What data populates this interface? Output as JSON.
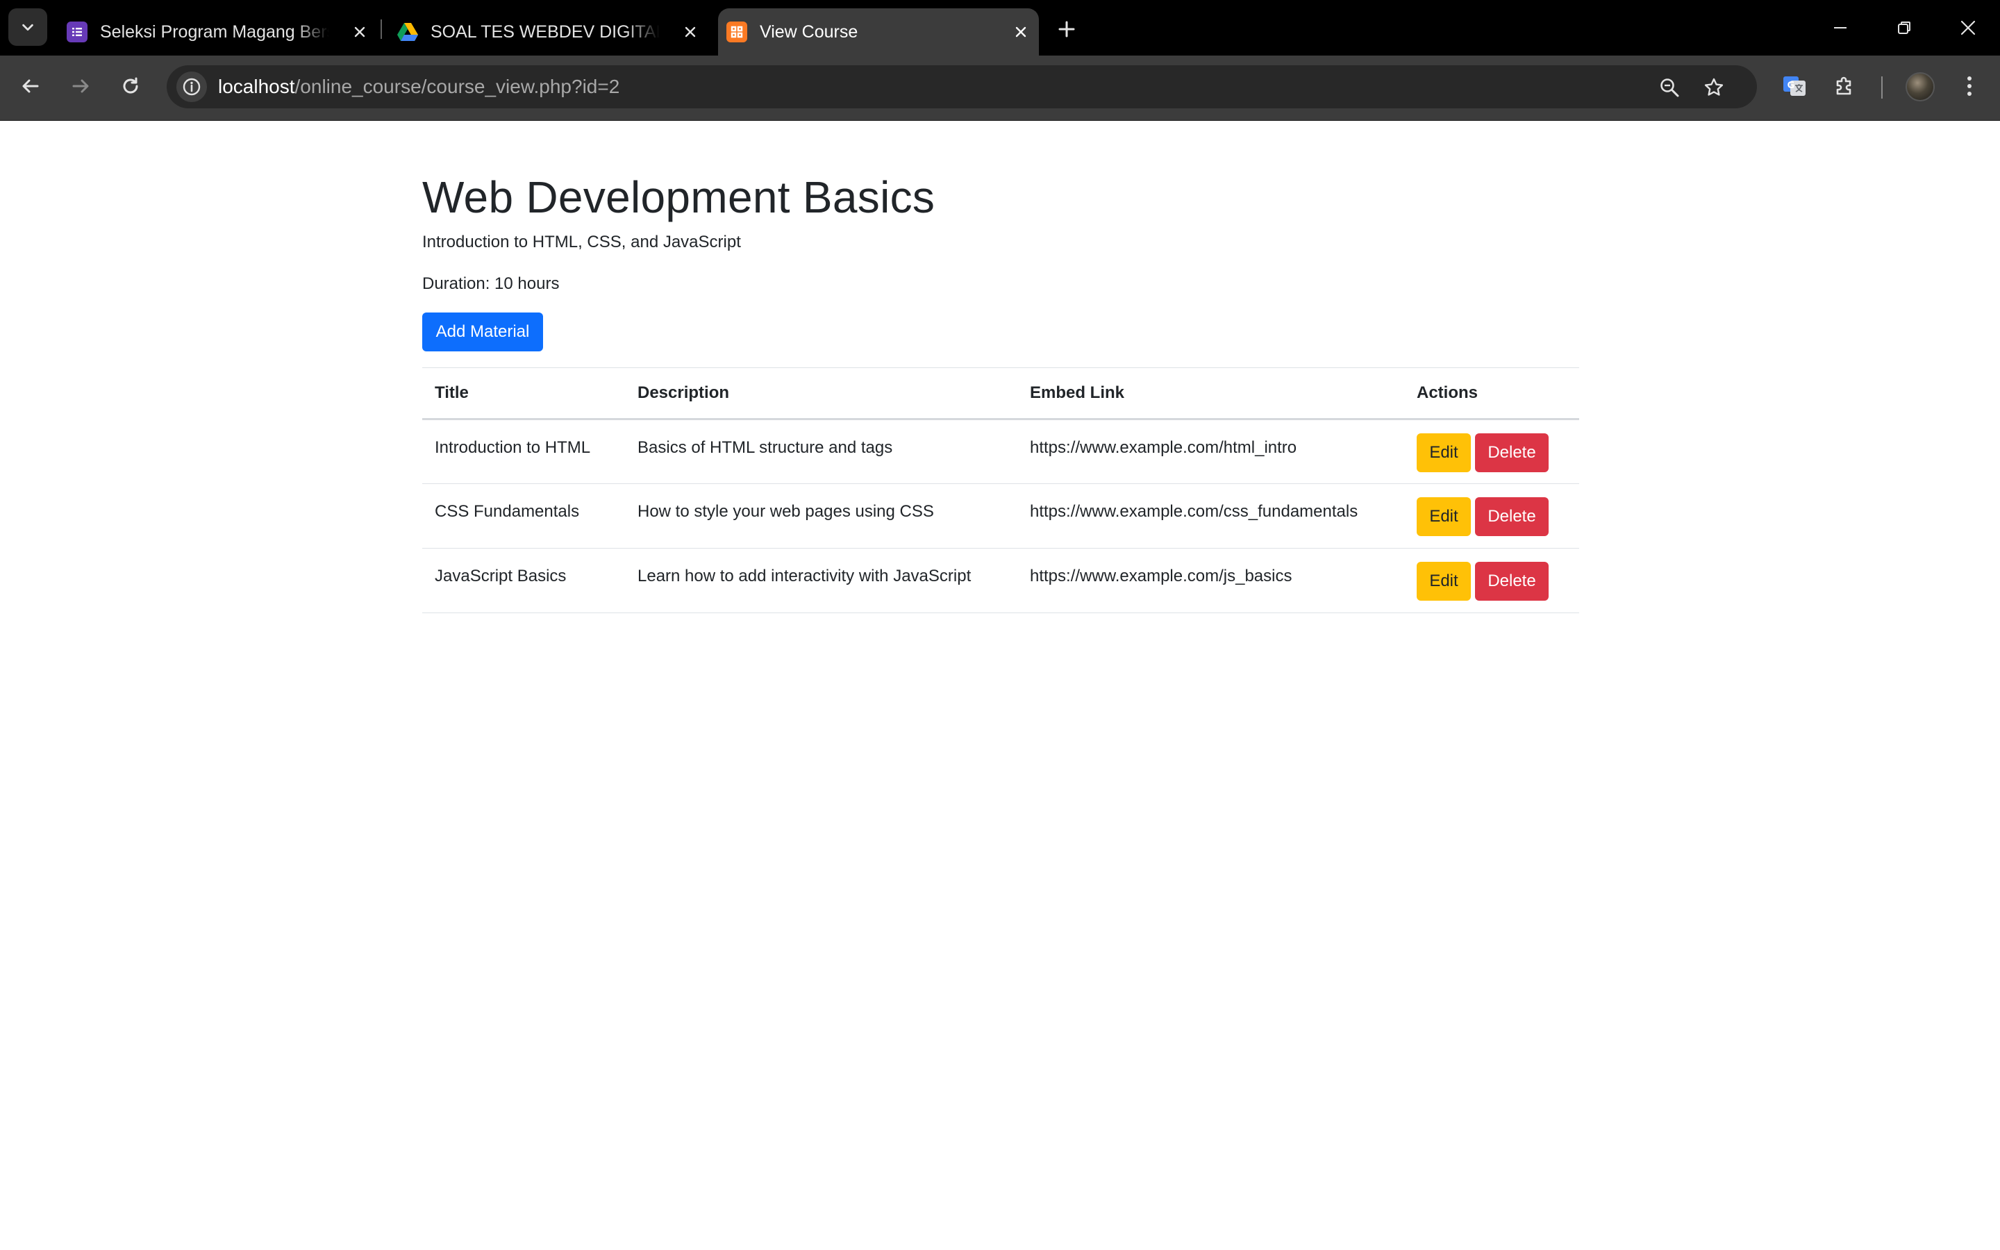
{
  "browser": {
    "tabs": [
      {
        "title": "Seleksi Program Magang Bersertifikat",
        "favicon": "forms-icon",
        "active": false
      },
      {
        "title": "SOAL TES WEBDEV DIGITALIZ B",
        "favicon": "drive-icon",
        "active": false
      },
      {
        "title": "View Course",
        "favicon": "xampp-icon",
        "active": true
      }
    ],
    "url": {
      "host": "localhost",
      "path": "/online_course/course_view.php?id=2"
    }
  },
  "course": {
    "title": "Web Development Basics",
    "description": "Introduction to HTML, CSS, and JavaScript",
    "duration": "Duration: 10 hours",
    "add_material_label": "Add Material"
  },
  "table": {
    "headers": {
      "title": "Title",
      "description": "Description",
      "embed_link": "Embed Link",
      "actions": "Actions"
    },
    "rows": [
      {
        "title": "Introduction to HTML",
        "description": "Basics of HTML structure and tags",
        "embed_link": "https://www.example.com/html_intro",
        "edit": "Edit",
        "delete": "Delete"
      },
      {
        "title": "CSS Fundamentals",
        "description": "How to style your web pages using CSS",
        "embed_link": "https://www.example.com/css_fundamentals",
        "edit": "Edit",
        "delete": "Delete"
      },
      {
        "title": "JavaScript Basics",
        "description": "Learn how to add interactivity with JavaScript",
        "embed_link": "https://www.example.com/js_basics",
        "edit": "Edit",
        "delete": "Delete"
      }
    ]
  },
  "colors": {
    "primary": "#0d6efd",
    "warning": "#ffc107",
    "danger": "#dc3545"
  }
}
